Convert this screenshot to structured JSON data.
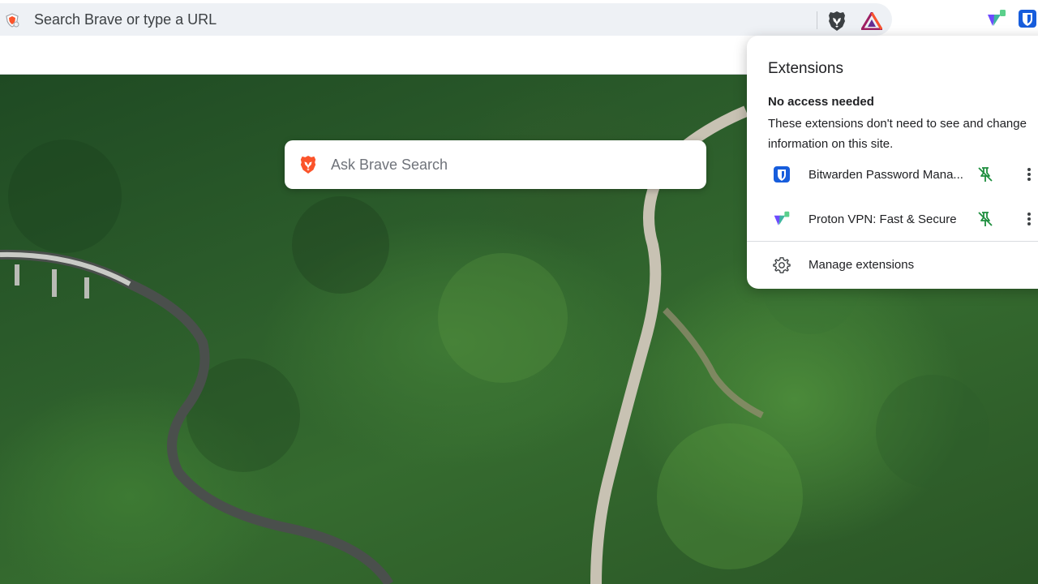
{
  "address_bar": {
    "placeholder": "Search Brave or type a URL"
  },
  "new_tab": {
    "search_placeholder": "Ask Brave Search"
  },
  "extensions_panel": {
    "title": "Extensions",
    "section_heading": "No access needed",
    "section_description": "These extensions don't need to see and change information on this site.",
    "items": [
      {
        "label": "Bitwarden Password Mana...",
        "icon": "bitwarden-icon"
      },
      {
        "label": "Proton VPN: Fast & Secure",
        "icon": "proton-vpn-icon"
      }
    ],
    "manage_label": "Manage extensions"
  },
  "colors": {
    "brave_orange": "#fb542b",
    "bitwarden_blue": "#175ddc",
    "pin_green": "#1e8e3e",
    "proton_purple": "#6d4aff"
  }
}
